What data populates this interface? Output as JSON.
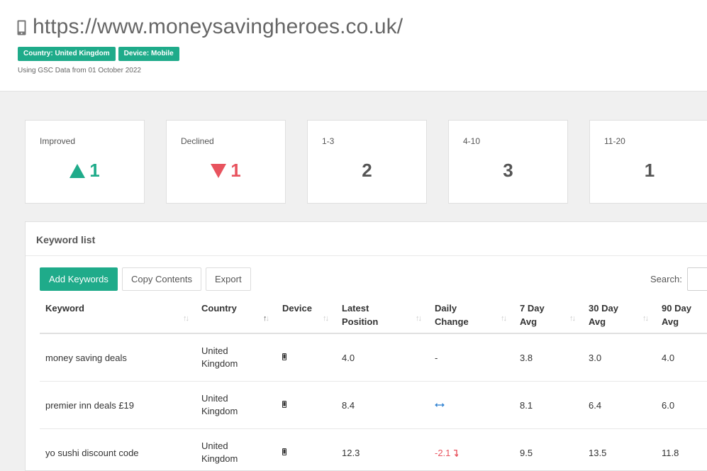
{
  "header": {
    "url": "https://www.moneysavingheroes.co.uk/",
    "badges": [
      "Country: United Kingdom",
      "Device: Mobile"
    ],
    "note": "Using GSC Data from 01 October 2022"
  },
  "stats": [
    {
      "label": "Improved",
      "value": "1",
      "icon": "triangle-up-icon",
      "color": "#1fab8a"
    },
    {
      "label": "Declined",
      "value": "1",
      "icon": "triangle-down-icon",
      "color": "#e8535e"
    },
    {
      "label": "1-3",
      "value": "2"
    },
    {
      "label": "4-10",
      "value": "3"
    },
    {
      "label": "11-20",
      "value": "1"
    }
  ],
  "panel": {
    "title": "Keyword list",
    "buttons": {
      "add": "Add Keywords",
      "copy": "Copy Contents",
      "export": "Export"
    },
    "search_label": "Search:"
  },
  "table": {
    "headers": [
      [
        "Keyword",
        ""
      ],
      [
        "Country",
        ""
      ],
      [
        "Device",
        ""
      ],
      [
        "Latest",
        "Position"
      ],
      [
        "Daily",
        "Change"
      ],
      [
        "7 Day",
        "Avg"
      ],
      [
        "30 Day",
        "Avg"
      ],
      [
        "90 Day",
        "Avg"
      ]
    ],
    "rows": [
      {
        "keyword": "money saving deals",
        "country": [
          "United",
          "Kingdom"
        ],
        "device": "mobile-icon",
        "latest": "4.0",
        "daily": "-",
        "avg7": "3.8",
        "avg30": "3.0",
        "avg90": "4.0"
      },
      {
        "keyword": "premier inn deals £19",
        "country": [
          "United",
          "Kingdom"
        ],
        "device": "mobile-icon",
        "latest": "8.4",
        "daily": "",
        "daily_icon": "no-change-arrows-icon",
        "avg7": "8.1",
        "avg30": "6.4",
        "avg90": "6.0"
      },
      {
        "keyword": "yo sushi discount code",
        "country": [
          "United",
          "Kingdom"
        ],
        "device": "mobile-icon",
        "latest": "12.3",
        "daily": "-2.1",
        "daily_icon": "down-arrow-icon",
        "avg7": "9.5",
        "avg30": "13.5",
        "avg90": "11.8"
      }
    ]
  }
}
